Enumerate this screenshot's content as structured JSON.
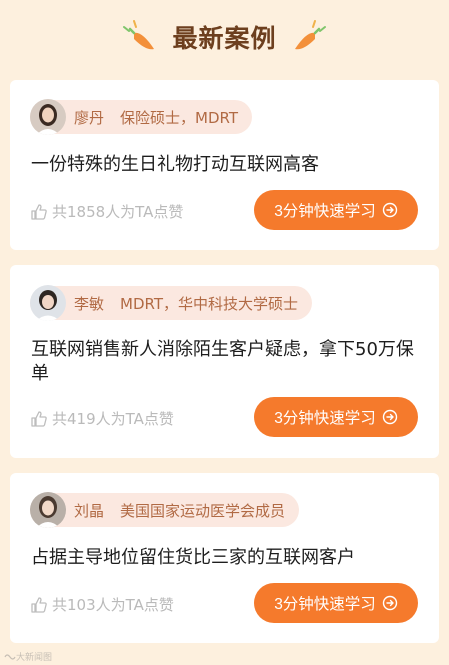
{
  "header": {
    "title": "最新案例"
  },
  "cases": [
    {
      "author_name": "廖丹",
      "author_title": "保险硕士，MDRT",
      "title": "一份特殊的生日礼物打动互联网高客",
      "likes": "共1858人为TA点赞",
      "button_label": "3分钟快速学习"
    },
    {
      "author_name": "李敏",
      "author_title": "MDRT，华中科技大学硕士",
      "title": "互联网销售新人消除陌生客户疑虑，拿下50万保单",
      "likes": "共419人为TA点赞",
      "button_label": "3分钟快速学习"
    },
    {
      "author_name": "刘晶",
      "author_title": "美国国家运动医学会成员",
      "title": "占据主导地位留住货比三家的互联网客户",
      "likes": "共103人为TA点赞",
      "button_label": "3分钟快速学习"
    }
  ],
  "watermark": "大新闻图",
  "colors": {
    "background": "#fdf0de",
    "accent": "#f57a2c",
    "pill": "#fbe8e0",
    "author_text": "#b16a44"
  },
  "icons": {
    "like": "thumbs-up-icon",
    "button": "arrow-right-circle-icon",
    "decoration": "carrot-decoration-icon"
  }
}
